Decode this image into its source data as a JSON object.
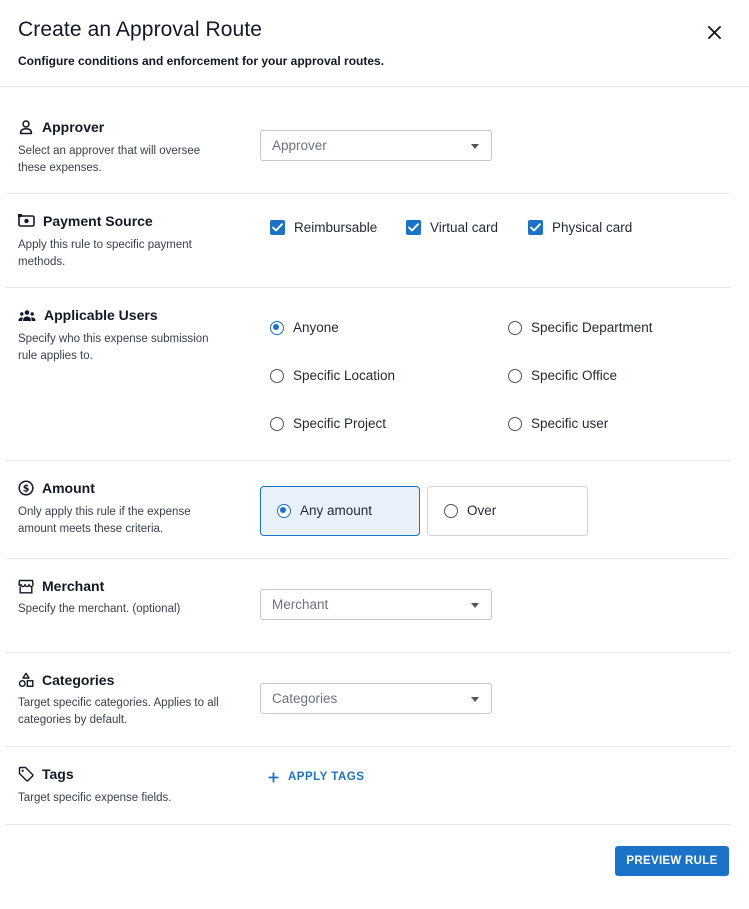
{
  "modal": {
    "title": "Create an Approval Route",
    "subtitle": "Configure conditions and enforcement for your approval routes."
  },
  "approver": {
    "title": "Approver",
    "icon": "person-icon",
    "description": "Select an approver that will oversee these expenses.",
    "placeholder": "Approver"
  },
  "payment_source": {
    "title": "Payment Source",
    "icon": "payment-icon",
    "description": "Apply this rule to specific payment methods.",
    "options": [
      {
        "label": "Reimbursable",
        "checked": true
      },
      {
        "label": "Virtual card",
        "checked": true
      },
      {
        "label": "Physical card",
        "checked": true
      }
    ]
  },
  "applicable_users": {
    "title": "Applicable Users",
    "icon": "users-icon",
    "description": "Specify who this expense submission rule applies to.",
    "options": [
      {
        "label": "Anyone",
        "selected": true
      },
      {
        "label": "Specific Department",
        "selected": false
      },
      {
        "label": "Specific Location",
        "selected": false
      },
      {
        "label": "Specific Office",
        "selected": false
      },
      {
        "label": "Specific Project",
        "selected": false
      },
      {
        "label": "Specific user",
        "selected": false
      }
    ]
  },
  "amount": {
    "title": "Amount",
    "icon": "dollar-circle-icon",
    "description": "Only apply this rule if the expense amount meets these criteria.",
    "options": [
      {
        "label": "Any amount",
        "selected": true
      },
      {
        "label": "Over",
        "selected": false
      }
    ]
  },
  "merchant": {
    "title": "Merchant",
    "icon": "storefront-icon",
    "description": "Specify the merchant. (optional)",
    "placeholder": "Merchant"
  },
  "categories": {
    "title": "Categories",
    "icon": "shapes-icon",
    "description": "Target specific categories. Applies to all categories by default.",
    "placeholder": "Categories"
  },
  "tags": {
    "title": "Tags",
    "icon": "tag-icon",
    "description": "Target specific expense fields.",
    "action_label": "APPLY TAGS"
  },
  "footer": {
    "preview_label": "PREVIEW RULE"
  },
  "colors": {
    "accent": "#1a73c9",
    "selected_bg": "#e8f1fa",
    "divider": "#e5e7eb"
  }
}
